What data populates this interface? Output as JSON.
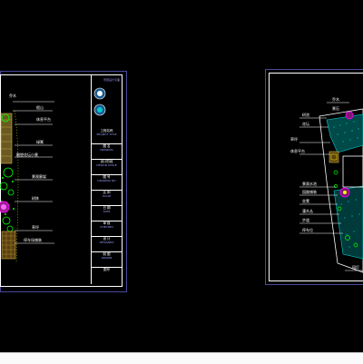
{
  "drawing_left": {
    "callouts": [
      {
        "id": "c1",
        "text": "乔木"
      },
      {
        "id": "c2",
        "text": "假山"
      },
      {
        "id": "c3",
        "text": "休息平台"
      },
      {
        "id": "c4",
        "text": "绿篱"
      },
      {
        "id": "c5",
        "text": "雕塑花坛小景"
      },
      {
        "id": "c6",
        "text": "景观廊架"
      },
      {
        "id": "c7",
        "text": "树阵"
      },
      {
        "id": "c8",
        "text": "草坪"
      },
      {
        "id": "c9",
        "text": "停车场铺装"
      }
    ],
    "title_block": {
      "header": "景观设计平面",
      "rows": [
        {
          "label": "工程名称",
          "value": "PROJECT TITLE"
        },
        {
          "label": "图 名",
          "value": "DRAWING"
        },
        {
          "label": "设计阶段",
          "value": "DESIGN STAGE"
        },
        {
          "label": "图 号",
          "value": "DRAWING NO"
        },
        {
          "label": "比 例",
          "value": "SCALE"
        },
        {
          "label": "日 期",
          "value": "DATE"
        },
        {
          "label": "审 核",
          "value": "CHECKED"
        },
        {
          "label": "设 计",
          "value": "DESIGNED"
        },
        {
          "label": "制 图",
          "value": "DRAWN"
        }
      ],
      "footer": "图号"
    }
  },
  "drawing_right": {
    "callouts": [
      {
        "id": "r1",
        "text": "乔木"
      },
      {
        "id": "r2",
        "text": "树池"
      },
      {
        "id": "r3",
        "text": "花坛"
      },
      {
        "id": "r4",
        "text": "草坪"
      },
      {
        "id": "r5",
        "text": "休息平台"
      },
      {
        "id": "r6",
        "text": "景观水池"
      },
      {
        "id": "r7",
        "text": "园路铺装"
      },
      {
        "id": "r8",
        "text": "坐凳"
      },
      {
        "id": "r9",
        "text": "灌木丛"
      },
      {
        "id": "r10",
        "text": "步道"
      },
      {
        "id": "r11",
        "text": "停车位"
      },
      {
        "id": "r12",
        "text": "园灯"
      },
      {
        "id": "r13",
        "text": "景石"
      }
    ]
  },
  "colors": {
    "frame": "#ffffff",
    "sheet": "#4a4a9a",
    "hatch": "#00cccc",
    "plant": "#00ff00",
    "accent": "#ff00ff",
    "paving": "#d4b14a"
  }
}
